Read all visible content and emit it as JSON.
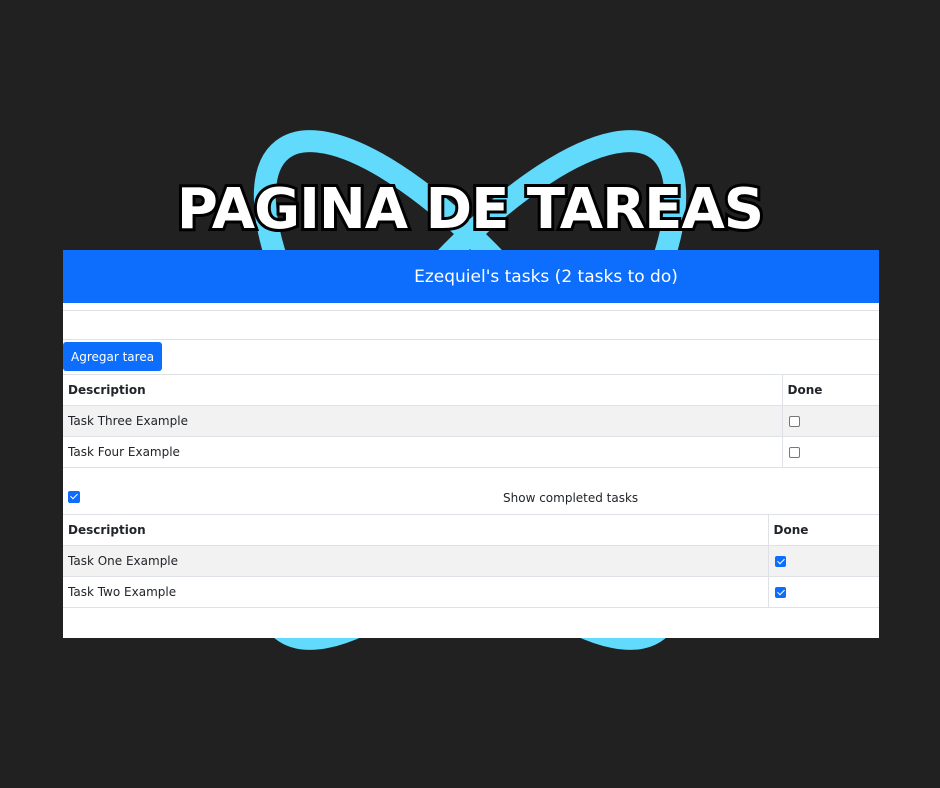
{
  "banner": {
    "title": "PAGINA DE TAREAS"
  },
  "colors": {
    "primary": "#0d6efd",
    "logo": "#61dafb",
    "background": "#212121"
  },
  "navbar": {
    "title": "Ezequiel's tasks (2 tasks to do)"
  },
  "task_input": {
    "value": "",
    "placeholder": ""
  },
  "add_button": {
    "label": "Agregar tarea"
  },
  "pending_table": {
    "headers": {
      "description": "Description",
      "done": "Done"
    },
    "rows": [
      {
        "description": "Task Three Example",
        "done": false
      },
      {
        "description": "Task Four Example",
        "done": false
      }
    ]
  },
  "show_completed": {
    "label": "Show completed tasks",
    "checked": true
  },
  "completed_table": {
    "headers": {
      "description": "Description",
      "done": "Done"
    },
    "rows": [
      {
        "description": "Task One Example",
        "done": true
      },
      {
        "description": "Task Two Example",
        "done": true
      }
    ]
  }
}
